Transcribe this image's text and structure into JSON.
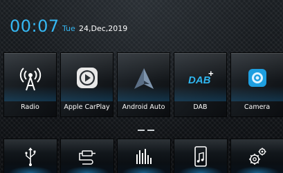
{
  "status": {
    "time": "00:07",
    "weekday": "Tue",
    "date": "24,Dec,2019"
  },
  "apps": [
    {
      "label": "Radio",
      "icon": "radio-antenna-icon"
    },
    {
      "label": "Apple CarPlay",
      "icon": "carplay-icon"
    },
    {
      "label": "Android Auto",
      "icon": "android-auto-icon"
    },
    {
      "label": "DAB",
      "icon": "dab-plus-icon"
    },
    {
      "label": "Camera",
      "icon": "camera-icon"
    }
  ],
  "dab_logo_text": "DAB",
  "dab_plus_text": "+",
  "dock": [
    {
      "icon": "usb-icon"
    },
    {
      "icon": "aux-cable-icon"
    },
    {
      "icon": "equalizer-icon"
    },
    {
      "icon": "phone-music-icon"
    },
    {
      "icon": "settings-gears-icon"
    }
  ],
  "colors": {
    "accent": "#35b7f2",
    "text": "#ffffff",
    "background": "#0c0f12"
  }
}
